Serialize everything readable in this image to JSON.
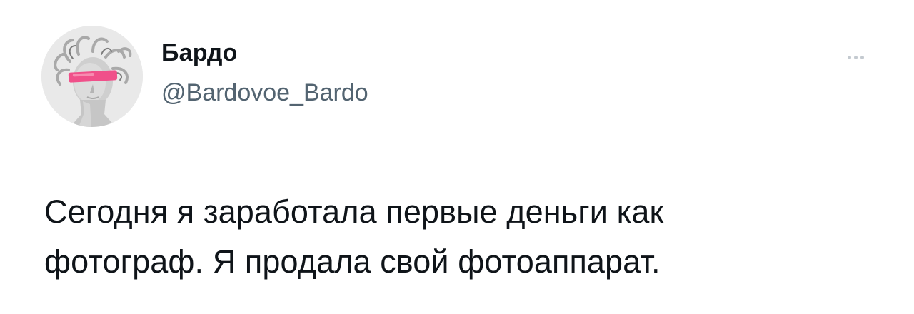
{
  "tweet": {
    "author": {
      "display_name": "Бардо",
      "handle": "@Bardovoe_Bardo",
      "avatar_icon": "medusa-statue-avatar"
    },
    "more_icon": "more-horizontal-icon",
    "text_lines": [
      "Сегодня я заработала первые деньги как",
      "фотограф. Я продала свой фотоаппарат."
    ]
  },
  "colors": {
    "text": "#0f1419",
    "secondary": "#536471",
    "background": "#ffffff",
    "avatar_accent": "#f0508a"
  }
}
